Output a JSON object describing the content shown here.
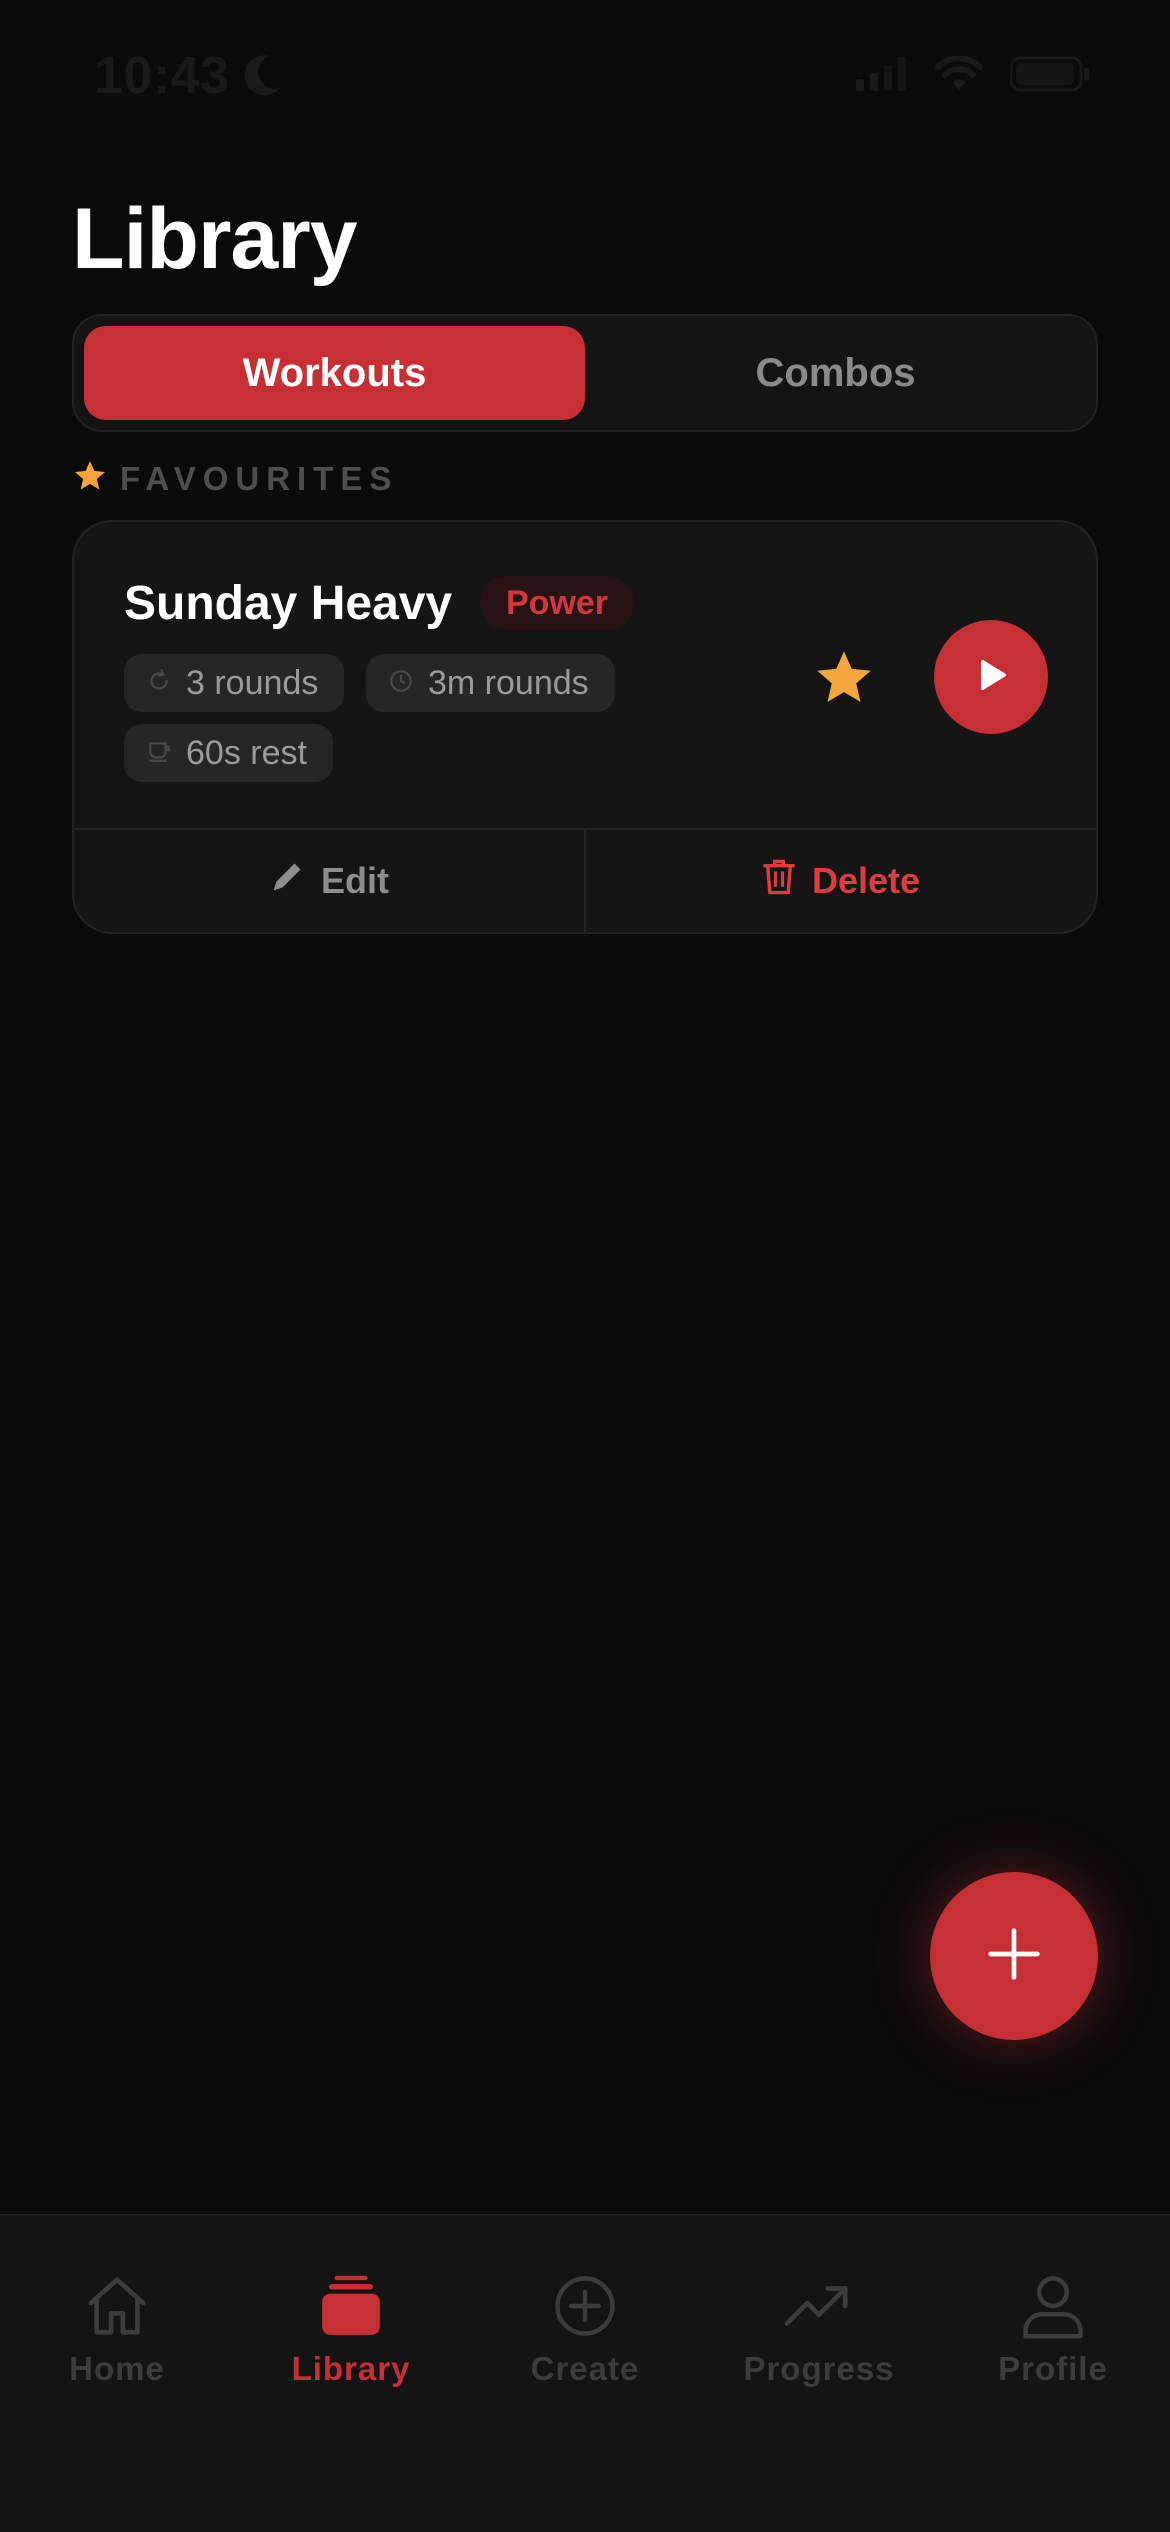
{
  "status_bar": {
    "time": "10:43"
  },
  "header": {
    "title": "Library"
  },
  "segments": {
    "workouts": "Workouts",
    "combos": "Combos"
  },
  "section": {
    "favourites": "FAVOURITES"
  },
  "workout_card": {
    "title": "Sunday Heavy",
    "tag": "Power",
    "rounds": "3 rounds",
    "round_length": "3m rounds",
    "rest": "60s rest",
    "edit_label": "Edit",
    "delete_label": "Delete"
  },
  "tab_bar": {
    "items": [
      {
        "label": "Home",
        "icon": "home-icon"
      },
      {
        "label": "Library",
        "icon": "library-icon"
      },
      {
        "label": "Create",
        "icon": "plus-circle-icon"
      },
      {
        "label": "Progress",
        "icon": "trend-up-icon"
      },
      {
        "label": "Profile",
        "icon": "person-icon"
      }
    ],
    "active": "Library"
  },
  "colors": {
    "accent": "#c62f34",
    "star": "#f4a53c",
    "background": "#0b0b0b",
    "card": "#151515",
    "delete": "#dc3d3c"
  }
}
